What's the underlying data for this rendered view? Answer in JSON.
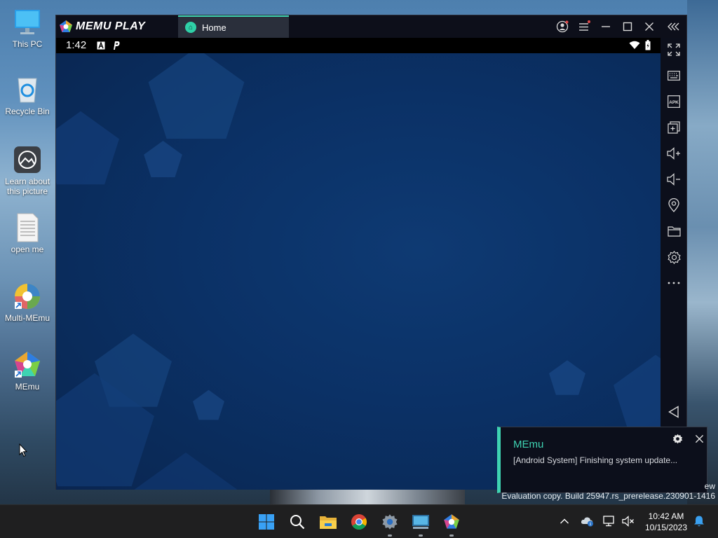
{
  "desktop": {
    "icons": [
      {
        "label": "This PC",
        "icon": "monitor-icon"
      },
      {
        "label": "Recycle Bin",
        "icon": "recycle-bin-icon"
      },
      {
        "label": "Learn about this picture",
        "icon": "camera-info-icon"
      },
      {
        "label": "open me",
        "icon": "text-document-icon"
      },
      {
        "label": "Multi-MEmu",
        "icon": "multi-memu-icon"
      },
      {
        "label": "MEmu",
        "icon": "memu-icon"
      }
    ]
  },
  "memu": {
    "logo_text": "MEMU PLAY",
    "tab_label": "Home",
    "status_time": "1:42",
    "status_icons": [
      "notification-a-icon",
      "notification-p-icon"
    ],
    "status_right_icons": [
      "wifi-icon",
      "battery-icon"
    ],
    "title_buttons": [
      "account-icon",
      "menu-icon",
      "minimize-icon",
      "maximize-icon",
      "close-icon",
      "collapse-sidebar-icon"
    ],
    "sidebar_buttons": [
      "fullscreen-icon",
      "keyboard-icon",
      "apk-icon",
      "multi-window-icon",
      "volume-up-icon",
      "volume-down-icon",
      "location-icon",
      "folder-icon",
      "settings-icon",
      "more-icon",
      "back-icon"
    ],
    "accent_color": "#3ed3b2"
  },
  "notification": {
    "title": "MEmu",
    "body": "[Android System] Finishing system update..."
  },
  "watermark": {
    "line1": "ew",
    "line2": "Evaluation copy. Build 25947.rs_prerelease.230901-1416"
  },
  "taskbar": {
    "apps": [
      "start-icon",
      "search-icon",
      "file-explorer-icon",
      "chrome-icon",
      "settings-icon",
      "memu-multi-taskbar-icon",
      "memu-taskbar-icon"
    ],
    "tray": [
      "show-hidden-icons-chevron",
      "onedrive-icon",
      "network-icon",
      "volume-muted-icon"
    ],
    "time": "10:42 AM",
    "date": "10/15/2023"
  }
}
